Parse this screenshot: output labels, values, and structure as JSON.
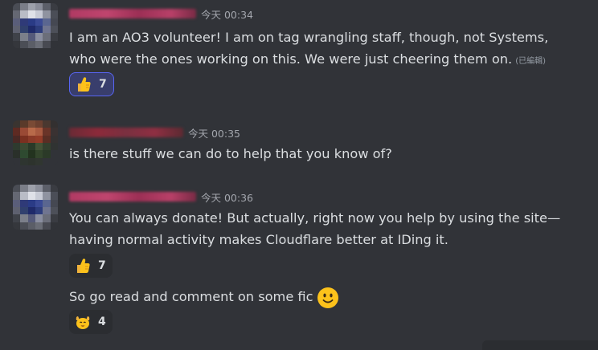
{
  "messages": [
    {
      "timestamp": "今天 00:34",
      "lines": [
        "I am an AO3 volunteer! I am on tag wrangling staff, though, not Systems,",
        "who were the ones working on this. We were just cheering them on."
      ],
      "edited_label": "(已編輯)",
      "reactions": [
        {
          "emoji": "thumbs-up-icon",
          "count": "7",
          "active": true
        }
      ]
    },
    {
      "timestamp": "今天 00:35",
      "lines": [
        "is there stuff we can do to help that you know of?"
      ]
    },
    {
      "timestamp": "今天 00:36",
      "lines": [
        "You can always donate! But actually, right now you help by using the site—",
        "having normal activity makes Cloudflare better at IDing it."
      ],
      "reactions": [
        {
          "emoji": "thumbs-up-icon",
          "count": "7",
          "active": false
        }
      ]
    },
    {
      "lines": [
        "So go read and comment on some fic"
      ],
      "inline_emoji": "slightly-smiling-face-icon",
      "reactions": [
        {
          "emoji": "raised-hands-face-icon",
          "count": "4",
          "active": false
        }
      ]
    }
  ],
  "colors": {
    "background": "#313338",
    "text": "#dbdee1",
    "timestamp": "#a3a6ad",
    "reaction_bg": "#2b2d31",
    "reaction_active_bg": "#393e6c",
    "reaction_active_border": "#5865f2",
    "name_blur_pink": "#b03a63",
    "name_blur_red": "#8c2a3a"
  }
}
